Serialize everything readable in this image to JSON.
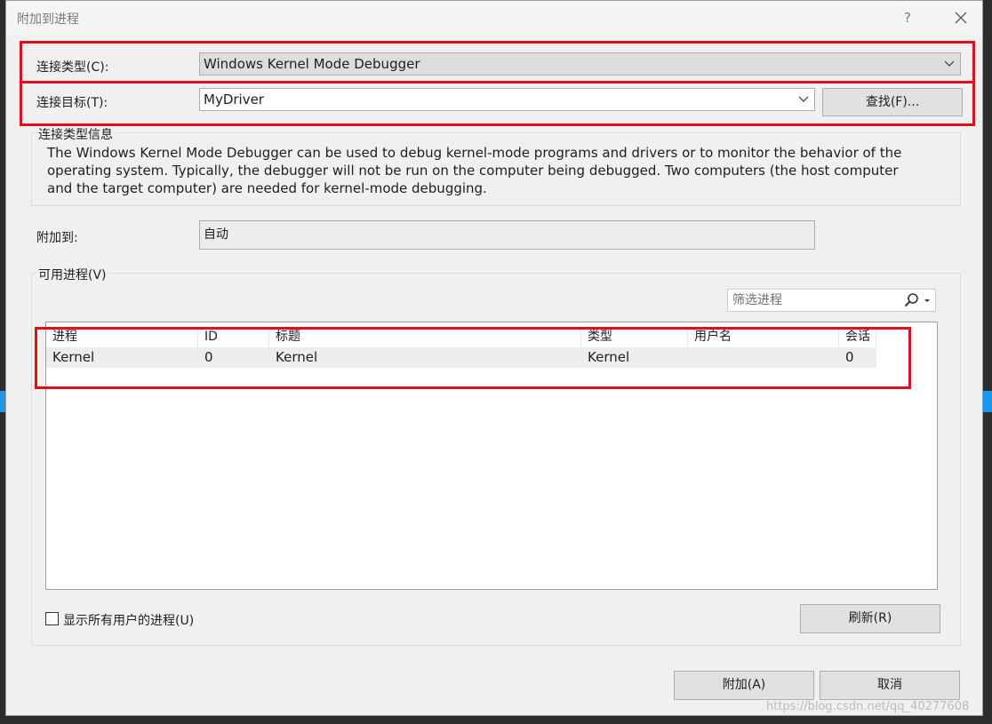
{
  "dialog": {
    "title": "附加到进程",
    "help_label": "?",
    "close_label": "✕"
  },
  "connection_type": {
    "label": "连接类型(C):",
    "value": "Windows Kernel Mode Debugger"
  },
  "connection_target": {
    "label": "连接目标(T):",
    "value": "MyDriver",
    "find_button": "查找(F)..."
  },
  "connection_info": {
    "title": "连接类型信息",
    "text": "The Windows Kernel Mode Debugger can be used to debug kernel-mode programs and drivers or to monitor the behavior of the operating system. Typically, the debugger will not be run on the computer being debugged. Two computers (the host computer and the target computer) are needed for kernel-mode debugging."
  },
  "attach_to": {
    "label": "附加到:",
    "value": "自动"
  },
  "available_processes": {
    "title": "可用进程(V)",
    "filter_placeholder": "筛选进程",
    "columns": [
      "进程",
      "ID",
      "标题",
      "类型",
      "用户名",
      "会话"
    ],
    "rows": [
      {
        "process": "Kernel",
        "id": "0",
        "title": "Kernel",
        "type": "Kernel",
        "user": "",
        "session": "0"
      }
    ],
    "show_all_users_label": "显示所有用户的进程(U)",
    "show_all_users_checked": false,
    "refresh_button": "刷新(R)"
  },
  "footer": {
    "attach_button": "附加(A)",
    "cancel_button": "取消"
  },
  "watermark": "https://blog.csdn.net/qq_40277608",
  "colors": {
    "highlight": "#e0101a",
    "dialog_bg": "#f0f0f0",
    "accent": "#1c97ea"
  }
}
